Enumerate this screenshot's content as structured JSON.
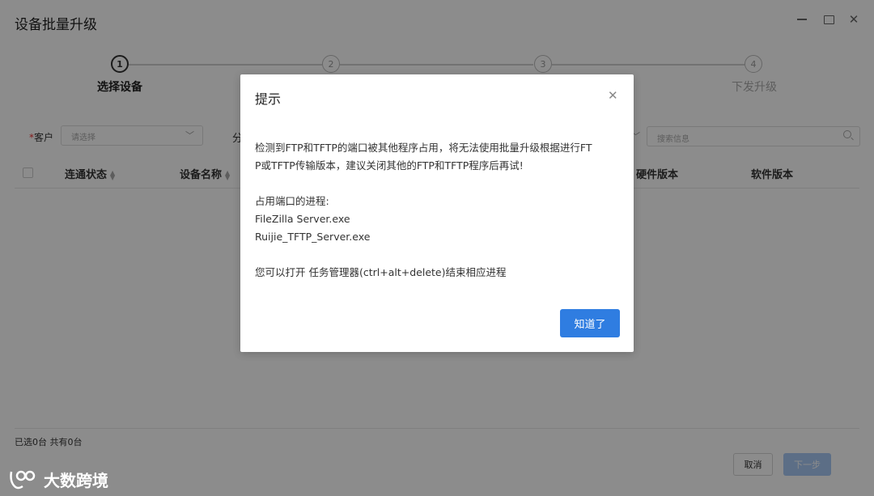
{
  "window": {
    "title": "设备批量升级"
  },
  "steps": [
    {
      "num": "1",
      "label": "选择设备"
    },
    {
      "num": "2",
      "label": ""
    },
    {
      "num": "3",
      "label": ""
    },
    {
      "num": "4",
      "label": "下发升级"
    }
  ],
  "filters": {
    "customer_label": "客户",
    "customer_required_mark": "*",
    "customer_placeholder": "请选择",
    "partial_label": "分",
    "search_placeholder": "搜索信息"
  },
  "table": {
    "columns": [
      "连通状态",
      "设备名称",
      "硬件版本",
      "软件版本"
    ]
  },
  "footer": {
    "count_text": "已选0台 共有0台",
    "cancel_label": "取消",
    "next_label": "下一步"
  },
  "watermark": {
    "text": "大数跨境"
  },
  "dialog": {
    "title": "提示",
    "line1": "检测到FTP和TFTP的端口被其他程序占用，将无法使用批量升级根据进行FT",
    "line2": "P或TFTP传输版本，建议关闭其他的FTP和TFTP程序后再试!",
    "process_heading": "占用端口的进程:",
    "process1": "FileZilla Server.exe",
    "process2": "Ruijie_TFTP_Server.exe",
    "hint": "您可以打开 任务管理器(ctrl+alt+delete)结束相应进程",
    "ok_label": "知道了"
  }
}
